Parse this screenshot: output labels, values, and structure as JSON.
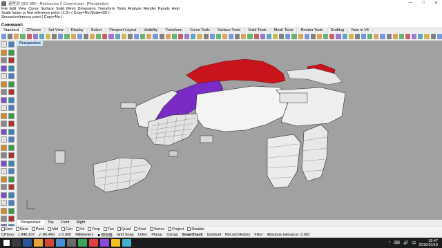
{
  "titlebar": {
    "title": "造型测 (259 MB) - Rhinoceros 6 Commercial - [Perspective]",
    "minimize": "—",
    "maximize": "□",
    "close": "✕"
  },
  "menu": [
    "File",
    "Edit",
    "View",
    "Curve",
    "Surface",
    "Solid",
    "Mesh",
    "Dimension",
    "Transform",
    "Tools",
    "Analyze",
    "Render",
    "Panels",
    "Help"
  ],
  "history": [
    "Scale factor or first reference point <1.0> ( Copy=No  Mode=3D ):",
    "Second reference point ( Copy=No ):"
  ],
  "command_prompt": "Command:",
  "tabs": [
    "Standard",
    "CPlanes",
    "Set View",
    "Display",
    "Select",
    "Viewport Layout",
    "Visibility",
    "Transform",
    "Curve Tools",
    "Surface Tools",
    "Solid Tools",
    "Mesh Tools",
    "Render Tools",
    "Drafting",
    "New in V6"
  ],
  "active_tab": "Standard",
  "viewport": {
    "title": "Perspective",
    "background": "#a1a1a1",
    "colors": {
      "red": "#c8141c",
      "purple": "#7a2bc4",
      "white": "#f4f4f4",
      "wire": "#2a2a2a"
    }
  },
  "view_tabs": [
    "Perspective",
    "Top",
    "Front",
    "Right"
  ],
  "active_view": "Perspective",
  "osnaps": [
    {
      "label": "End",
      "checked": false
    },
    {
      "label": "Near",
      "checked": false
    },
    {
      "label": "Point",
      "checked": false
    },
    {
      "label": "Mid",
      "checked": false
    },
    {
      "label": "Cen",
      "checked": false
    },
    {
      "label": "Int",
      "checked": false
    },
    {
      "label": "Perp",
      "checked": false
    },
    {
      "label": "Tan",
      "checked": false
    },
    {
      "label": "Quad",
      "checked": false
    },
    {
      "label": "Knot",
      "checked": false
    },
    {
      "label": "Vertex",
      "checked": false
    },
    {
      "label": "Project",
      "checked": false
    },
    {
      "label": "Disable",
      "checked": false
    }
  ],
  "status": {
    "cplane": "CPlane",
    "x": "x 846.107",
    "y": "y -86.490",
    "z": "z 0.000",
    "units": "Millimeters",
    "layer": "■ 预设值",
    "toggles": [
      "Grid Snap",
      "Ortho",
      "Planar",
      "Osnap",
      "SmartTrack",
      "Gumball",
      "Record History",
      "Filter"
    ],
    "tolerance": "Absolute tolerance: 0.001"
  },
  "taskbar": {
    "time": "18:47",
    "date": "2019/10/18",
    "lang": "中",
    "tray": [
      "^",
      "⌨",
      "🔊"
    ]
  }
}
